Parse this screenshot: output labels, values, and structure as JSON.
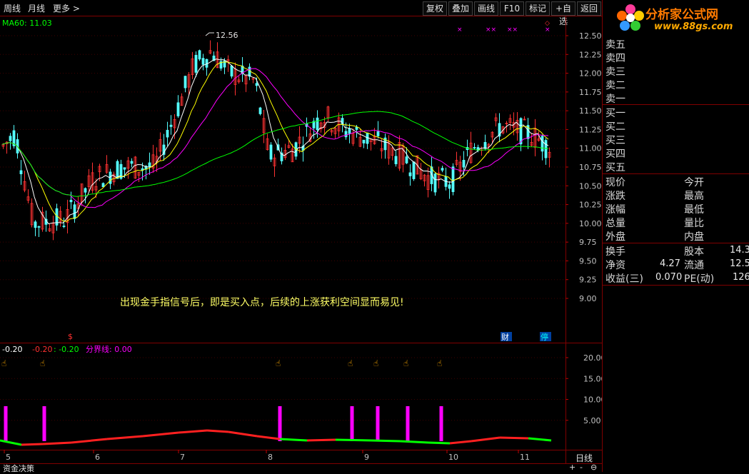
{
  "toolbar": {
    "left": [
      "周线",
      "月线",
      "更多 >"
    ],
    "right": [
      "复权",
      "叠加",
      "画线",
      "F10",
      "标记",
      "+自选",
      "返回"
    ]
  },
  "price_chart": {
    "ma_label": "MA60: 11.03",
    "high_mark": "12.56",
    "annotation": "出现金手指信号后，即是买入点，后续的上涨获利空间显而易见!",
    "event_tags": [
      "财",
      "停"
    ],
    "y_ticks": [
      "12.50",
      "12.25",
      "12.00",
      "11.75",
      "11.50",
      "11.25",
      "11.00",
      "10.75",
      "10.50",
      "10.25",
      "10.00",
      "9.75",
      "9.50",
      "9.25",
      "9.00"
    ],
    "colors": {
      "up": "#ff3232",
      "down": "#54ffff",
      "ma5": "#ffffff",
      "ma10": "#ffff00",
      "ma20": "#ff00ff",
      "ma60": "#00ff00"
    }
  },
  "indicator": {
    "labels": [
      "-0.20",
      "-0.20",
      ": -0.20",
      "分界线: 0.00"
    ],
    "y_ticks": [
      "20.00",
      "15.00",
      "10.00",
      "5.00"
    ],
    "signals": [
      8,
      62,
      392,
      493,
      529,
      571,
      618
    ],
    "colors": {
      "bar": "#ff00ff",
      "line_up": "#ff2020",
      "line_down": "#00ff00"
    }
  },
  "x_axis": {
    "ticks": [
      "5",
      "6",
      "7",
      "8",
      "9",
      "10",
      "11"
    ],
    "period": "日线"
  },
  "bottom": {
    "tab": "资金决策",
    "controls": [
      "+",
      "-",
      "⊖"
    ]
  },
  "right_panel": {
    "logo_text": "分析家公式网",
    "logo_url": "www.88gs.com",
    "sell_rows": [
      "卖五",
      "卖四",
      "卖三",
      "卖二",
      "卖一"
    ],
    "buy_rows": [
      "买一",
      "买二",
      "买三",
      "买四",
      "买五"
    ],
    "quote_left": [
      "现价",
      "涨跌",
      "涨幅",
      "总量",
      "外盘"
    ],
    "quote_right": [
      "今开",
      "最高",
      "最低",
      "量比",
      "内盘"
    ],
    "fund": [
      {
        "k": "换手",
        "v": "",
        "k2": "股本",
        "v2": "14.3"
      },
      {
        "k": "净资",
        "v": "4.27",
        "k2": "流通",
        "v2": "12.5"
      },
      {
        "k": "收益(三)",
        "v": "0.070",
        "k2": "PE(动)",
        "v2": "126"
      }
    ]
  }
}
